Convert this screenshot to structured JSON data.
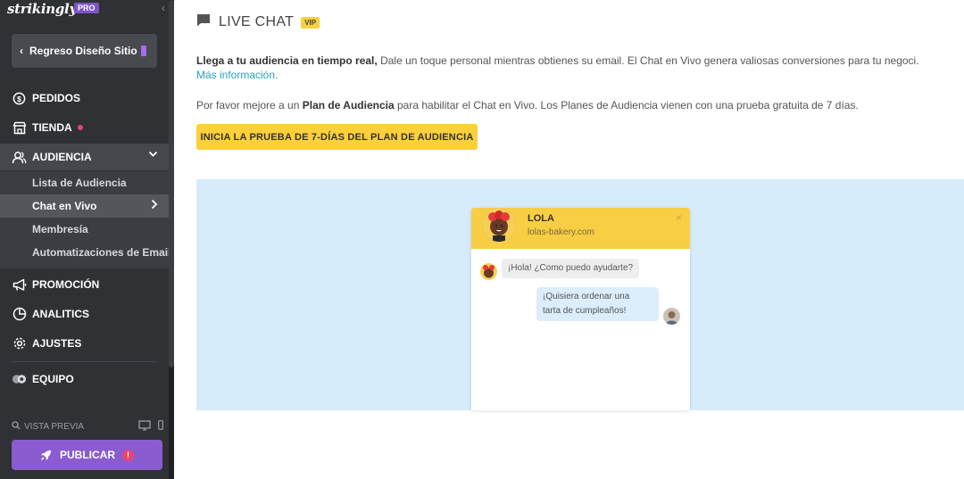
{
  "brand": {
    "logo": "strikingly",
    "badge": "PRO"
  },
  "sidebar": {
    "back_label": "Regreso Diseño Sitio",
    "items": [
      {
        "label": "PEDIDOS",
        "icon": "dollar-icon"
      },
      {
        "label": "TIENDA",
        "icon": "store-icon"
      },
      {
        "label": "AUDIENCIA",
        "icon": "audience-icon"
      },
      {
        "label": "PROMOCIÓN",
        "icon": "megaphone-icon"
      },
      {
        "label": "ANALITICS",
        "icon": "pie-chart-icon"
      },
      {
        "label": "AJUSTES",
        "icon": "gear-icon"
      },
      {
        "label": "EQUIPO",
        "icon": "team-icon"
      }
    ],
    "submenu": [
      {
        "label": "Lista de Audiencia"
      },
      {
        "label": "Chat en Vivo"
      },
      {
        "label": "Membresía"
      },
      {
        "label": "Automatizaciones de Email"
      }
    ],
    "preview_label": "VISTA PREVIA",
    "publish_label": "PUBLICAR",
    "publish_warning": "!"
  },
  "main": {
    "title": "LIVE CHAT",
    "vip_badge": "VIP",
    "intro_bold": "Llega a tu audiencia en tiempo real,",
    "intro_text": " Dale un toque personal mientras obtienes su email. El Chat en Vivo genera valiosas conversiones para tu negoci.",
    "intro_link": "Más información.",
    "upgrade_pre": "Por favor mejore a un ",
    "upgrade_bold": "Plan de Audiencia",
    "upgrade_post": " para habilitar el Chat en Vivo. Los Planes de Audiencia vienen con una prueba gratuita de 7 días.",
    "cta_label": "INICIA LA PRUEBA DE 7-DÍAS DEL PLAN DE AUDIENCIA"
  },
  "chat_preview": {
    "name": "LOLA",
    "site": "lolas-bakery.com",
    "close": "×",
    "message_in": "¡Hola! ¿Como puedo ayudarte?",
    "message_out_line1": "¡Quisiera ordenar una",
    "message_out_line2": "tarta de cumpleaños!"
  },
  "colors": {
    "sidebar_bg": "#2f3135",
    "accent_purple": "#8a5cd0",
    "cta_yellow": "#fbd03a",
    "link_teal": "#2aa3b8",
    "illustration_bg": "#d6ecfb"
  }
}
